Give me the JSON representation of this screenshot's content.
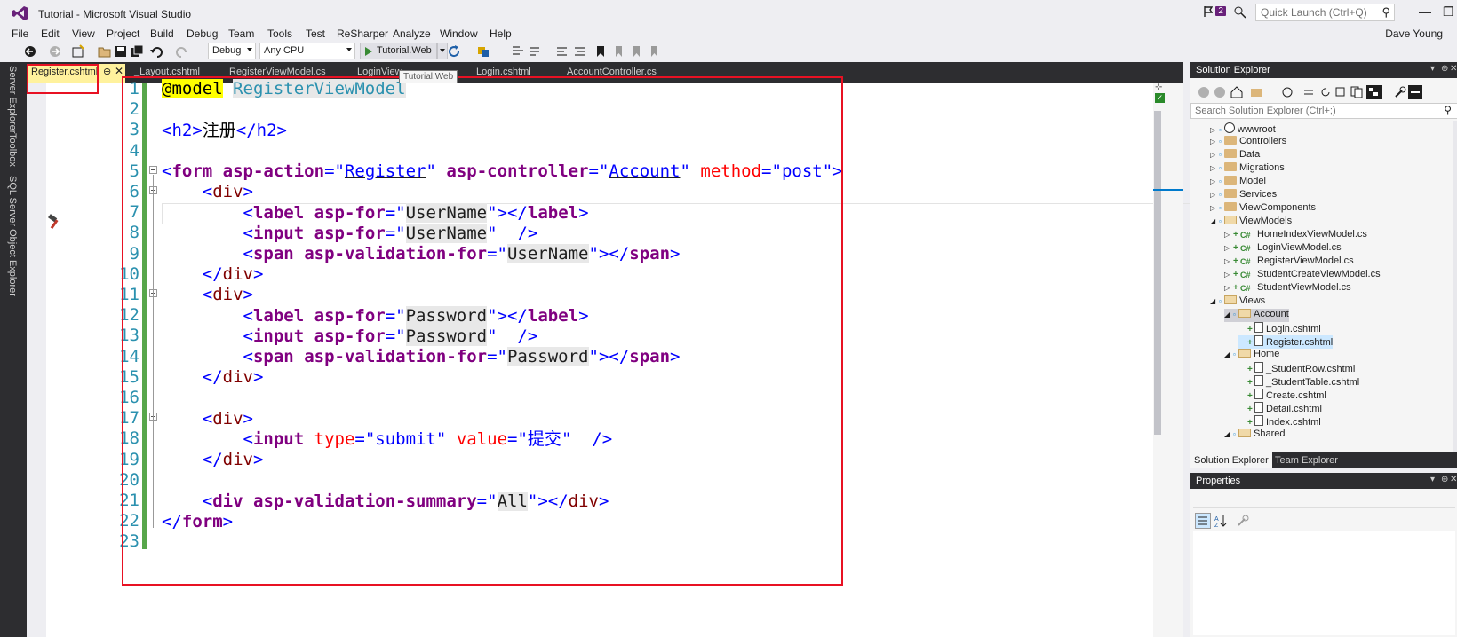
{
  "window": {
    "title": "Tutorial - Microsoft Visual Studio",
    "notification_count": "2",
    "quick_launch_placeholder": "Quick Launch (Ctrl+Q)",
    "user": "Dave Young",
    "minimize": "—",
    "restore": "❐"
  },
  "menu": [
    "File",
    "Edit",
    "View",
    "Project",
    "Build",
    "Debug",
    "Team",
    "Tools",
    "Test",
    "ReSharper",
    "Analyze",
    "Window",
    "Help"
  ],
  "toolbar": {
    "config": "Debug",
    "platform": "Any CPU",
    "run_target": "Tutorial.Web",
    "tooltip": "Tutorial.Web"
  },
  "side_tabs": [
    "Server Explorer",
    "Toolbox",
    "SQL Server Object Explorer"
  ],
  "doc_tabs": {
    "active": "Register.cshtml",
    "others": [
      "_Layout.cshtml",
      "RegisterViewModel.cs",
      "LoginView...",
      "Login.cshtml",
      "AccountController.cs"
    ]
  },
  "editor": {
    "line_numbers": [
      "1",
      "2",
      "3",
      "4",
      "5",
      "6",
      "7",
      "8",
      "9",
      "10",
      "11",
      "12",
      "13",
      "14",
      "15",
      "16",
      "17",
      "18",
      "19",
      "20",
      "21",
      "22",
      "23"
    ],
    "lines": {
      "l1_directive": "@model",
      "l1_type": "RegisterViewModel",
      "l3_open": "<h2>",
      "l3_text": "注册",
      "l3_close": "</h2>",
      "form_tag": "form",
      "form_attr1": "asp-action",
      "form_val1": "Register",
      "form_attr2": "asp-controller",
      "form_val2": "Account",
      "form_attr3": "method",
      "form_val3": "post",
      "div": "div",
      "label": "label",
      "input": "input",
      "span": "span",
      "asp_for": "asp-for",
      "asp_validation_for": "asp-validation-for",
      "username": "UserName",
      "password": "Password",
      "type_attr": "type",
      "type_val": "submit",
      "value_attr": "value",
      "value_val": "提交",
      "summary_attr": "asp-validation-summary",
      "summary_val": "All"
    }
  },
  "solution_explorer": {
    "title": "Solution Explorer",
    "search_placeholder": "Search Solution Explorer (Ctrl+;)",
    "tree": [
      {
        "label": "wwwroot",
        "kind": "globe",
        "depth": 0,
        "exp": "collapsed"
      },
      {
        "label": "Controllers",
        "kind": "folder",
        "depth": 0,
        "exp": "collapsed"
      },
      {
        "label": "Data",
        "kind": "folder",
        "depth": 0,
        "exp": "collapsed"
      },
      {
        "label": "Migrations",
        "kind": "folder",
        "depth": 0,
        "exp": "collapsed"
      },
      {
        "label": "Model",
        "kind": "folder",
        "depth": 0,
        "exp": "collapsed"
      },
      {
        "label": "Services",
        "kind": "folder",
        "depth": 0,
        "exp": "collapsed"
      },
      {
        "label": "ViewComponents",
        "kind": "folder",
        "depth": 0,
        "exp": "collapsed"
      },
      {
        "label": "ViewModels",
        "kind": "folder-open",
        "depth": 0,
        "exp": "expanded"
      },
      {
        "label": "HomeIndexViewModel.cs",
        "kind": "cs",
        "depth": 1,
        "exp": "collapsed"
      },
      {
        "label": "LoginViewModel.cs",
        "kind": "cs",
        "depth": 1,
        "exp": "collapsed"
      },
      {
        "label": "RegisterViewModel.cs",
        "kind": "cs",
        "depth": 1,
        "exp": "collapsed"
      },
      {
        "label": "StudentCreateViewModel.cs",
        "kind": "cs",
        "depth": 1,
        "exp": "collapsed"
      },
      {
        "label": "StudentViewModel.cs",
        "kind": "cs",
        "depth": 1,
        "exp": "collapsed"
      },
      {
        "label": "Views",
        "kind": "folder-open",
        "depth": 0,
        "exp": "expanded"
      },
      {
        "label": "Account",
        "kind": "folder-open",
        "depth": 1,
        "exp": "expanded",
        "state": "highlighted"
      },
      {
        "label": "Login.cshtml",
        "kind": "razor",
        "depth": 2,
        "exp": "none"
      },
      {
        "label": "Register.cshtml",
        "kind": "razor",
        "depth": 2,
        "exp": "none",
        "state": "selected"
      },
      {
        "label": "Home",
        "kind": "folder-open",
        "depth": 1,
        "exp": "expanded"
      },
      {
        "label": "_StudentRow.cshtml",
        "kind": "razor",
        "depth": 2,
        "exp": "none"
      },
      {
        "label": "_StudentTable.cshtml",
        "kind": "razor",
        "depth": 2,
        "exp": "none"
      },
      {
        "label": "Create.cshtml",
        "kind": "razor",
        "depth": 2,
        "exp": "none"
      },
      {
        "label": "Detail.cshtml",
        "kind": "razor",
        "depth": 2,
        "exp": "none"
      },
      {
        "label": "Index.cshtml",
        "kind": "razor",
        "depth": 2,
        "exp": "none"
      },
      {
        "label": "Shared",
        "kind": "folder-open",
        "depth": 1,
        "exp": "expanded"
      }
    ],
    "bottom_tabs": [
      "Solution Explorer",
      "Team Explorer"
    ]
  },
  "properties": {
    "title": "Properties"
  },
  "colors": {
    "accent": "#007acc",
    "annotation_red": "#e81123",
    "change_bar": "#57a64a",
    "dark_chrome": "#2d2d30"
  }
}
